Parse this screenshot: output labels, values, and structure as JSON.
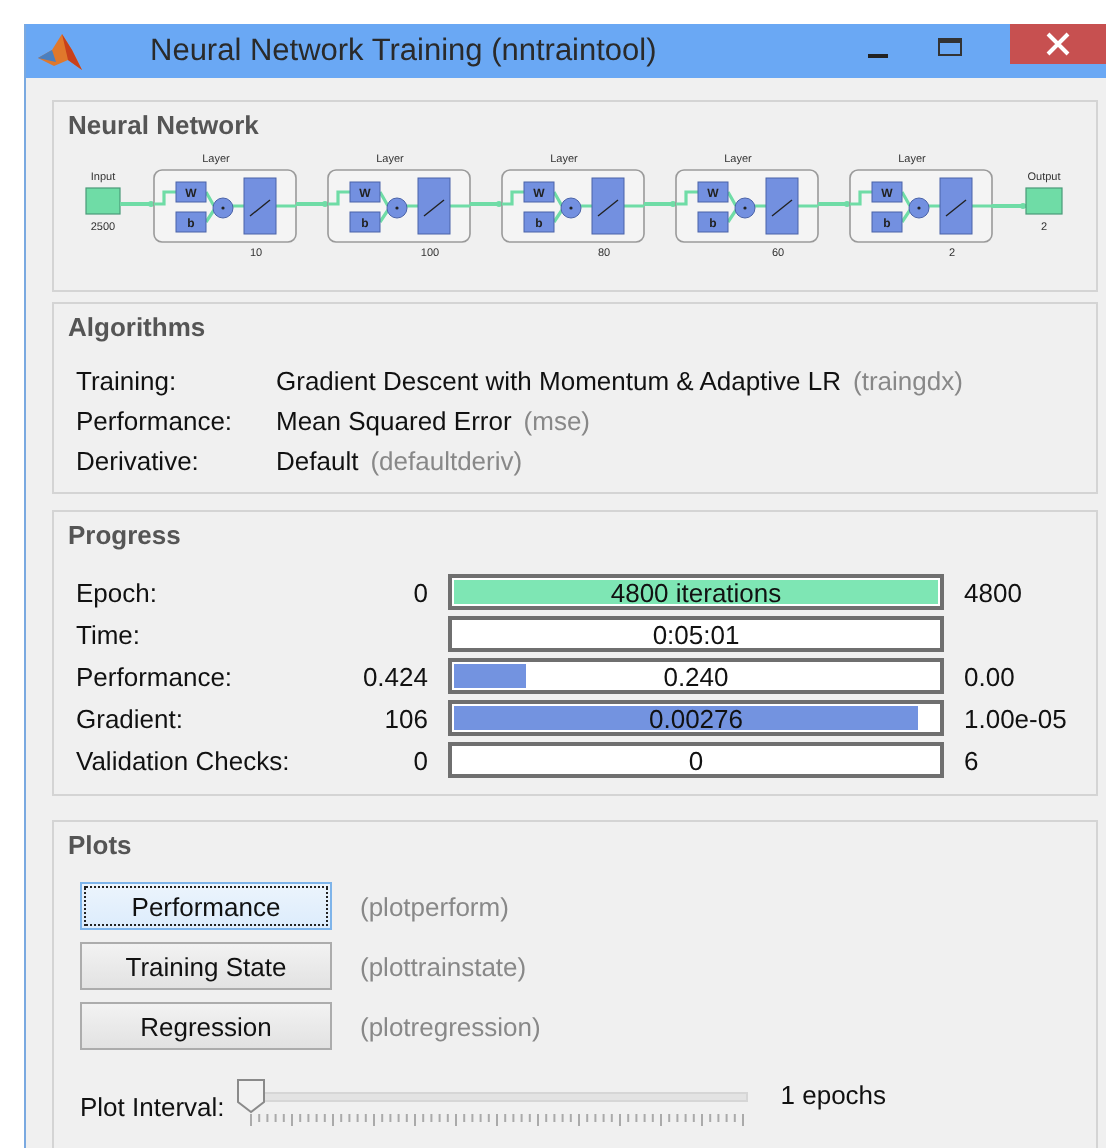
{
  "window": {
    "title": "Neural Network Training (nntraintool)"
  },
  "neural_network": {
    "title": "Neural Network",
    "input": {
      "label": "Input",
      "size": "2500"
    },
    "layers": [
      {
        "title": "Layer",
        "weight": "W",
        "bias": "b",
        "size": "10"
      },
      {
        "title": "Layer",
        "weight": "W",
        "bias": "b",
        "size": "100"
      },
      {
        "title": "Layer",
        "weight": "W",
        "bias": "b",
        "size": "80"
      },
      {
        "title": "Layer",
        "weight": "W",
        "bias": "b",
        "size": "60"
      },
      {
        "title": "Layer",
        "weight": "W",
        "bias": "b",
        "size": "2"
      }
    ],
    "output": {
      "label": "Output",
      "size": "2"
    }
  },
  "algorithms": {
    "title": "Algorithms",
    "rows": [
      {
        "label": "Training:",
        "value": "Gradient Descent with Momentum & Adaptive LR",
        "function": "(traingdx)"
      },
      {
        "label": "Performance:",
        "value": "Mean Squared Error",
        "function": "(mse)"
      },
      {
        "label": "Derivative:",
        "value": "Default",
        "function": "(defaultderiv)"
      }
    ]
  },
  "progress": {
    "title": "Progress",
    "rows": [
      {
        "label": "Epoch:",
        "start": "0",
        "reading": "4800 iterations",
        "end": "4800",
        "level": 1,
        "kind": "count"
      },
      {
        "label": "Time:",
        "reading": "0:05:01",
        "kind": "readout"
      },
      {
        "label": "Performance:",
        "start": "0.424",
        "reading": "0.240",
        "end": "0.00",
        "level": 0.15,
        "kind": "value"
      },
      {
        "label": "Gradient:",
        "start": "106",
        "reading": "0.00276",
        "end": "1.00e-05",
        "level": 0.96,
        "kind": "value"
      },
      {
        "label": "Validation Checks:",
        "start": "0",
        "reading": "0",
        "end": "6",
        "kind": "readout"
      }
    ]
  },
  "plots": {
    "title": "Plots",
    "buttons": [
      {
        "label": "Performance",
        "function": "(plotperform)",
        "focused": true
      },
      {
        "label": "Training State",
        "function": "(plottrainstate)",
        "focused": false
      },
      {
        "label": "Regression",
        "function": "(plotregression)",
        "focused": false
      }
    ],
    "plot_interval": {
      "label": "Plot Interval:",
      "level": 0,
      "reading": "1 epochs"
    }
  }
}
